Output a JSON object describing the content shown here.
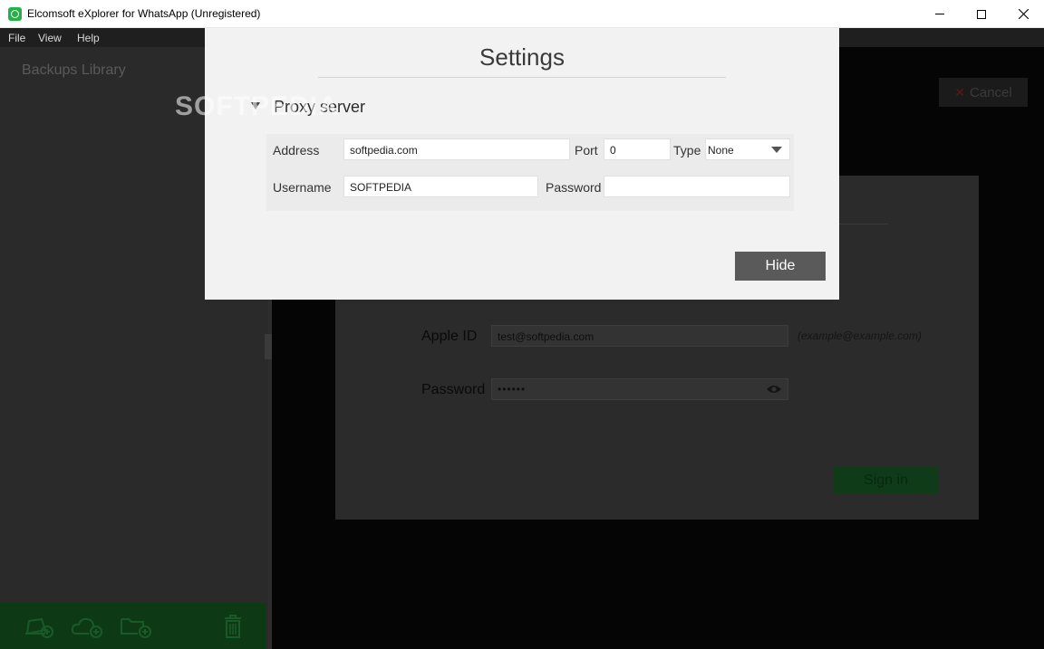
{
  "window": {
    "title": "Elcomsoft eXplorer for WhatsApp (Unregistered)"
  },
  "menu": {
    "file": "File",
    "view": "View",
    "help": "Help"
  },
  "sidebar": {
    "title": "Backups Library",
    "toolbar_icons": [
      "add-local-backup-icon",
      "add-cloud-backup-icon",
      "add-folder-icon",
      "trash-icon"
    ]
  },
  "header": {
    "cancel_label": "Cancel"
  },
  "login": {
    "apple_id_label": "Apple ID",
    "apple_id_value": "test@softpedia.com",
    "apple_id_hint": "(example@example.com)",
    "password_label": "Password",
    "password_value": "••••••",
    "signin_label": "Sign in"
  },
  "settings": {
    "title": "Settings",
    "section_title": "Proxy server",
    "address_label": "Address",
    "address_value": "softpedia.com",
    "port_label": "Port",
    "port_value": "0",
    "type_label": "Type",
    "type_value": "None",
    "username_label": "Username",
    "username_value": "SOFTPEDIA",
    "password_label": "Password",
    "password_value": "",
    "hide_label": "Hide"
  },
  "watermark": "SOFTPEDIA"
}
